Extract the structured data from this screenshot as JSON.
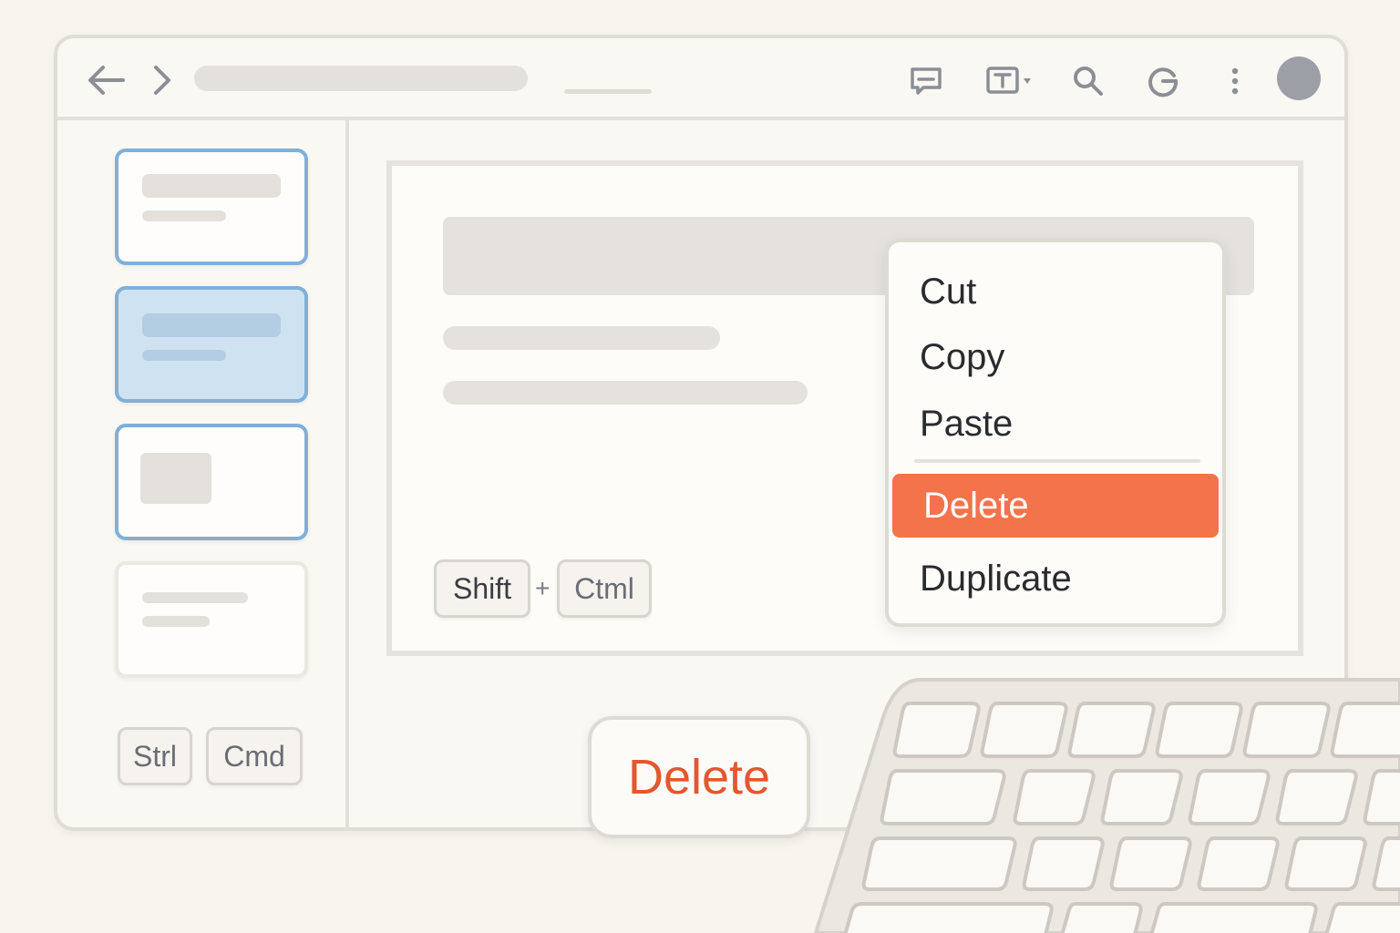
{
  "toolbar": {
    "icons": [
      "back-arrow-icon",
      "forward-chevron-icon",
      "comment-icon",
      "text-format-icon",
      "search-icon",
      "refresh-icon",
      "more-vertical-icon",
      "avatar"
    ]
  },
  "sidebar": {
    "slides": [
      {
        "state": "outlined"
      },
      {
        "state": "selected"
      },
      {
        "state": "outlined"
      },
      {
        "state": "plain"
      }
    ],
    "keys": [
      "Strl",
      "Cmd"
    ]
  },
  "canvas": {
    "shortcut": {
      "key1": "Shift",
      "plus": "+",
      "key2": "Ctml"
    }
  },
  "context_menu": {
    "items": [
      "Cut",
      "Copy",
      "Paste",
      "Delete",
      "Duplicate"
    ],
    "highlighted": "Delete"
  },
  "delete_key_label": "Delete",
  "colors": {
    "accent": "#f3734b",
    "delete_text": "#e4572e",
    "selection_border": "#7fb0d9",
    "selection_fill": "#cfe2f2"
  }
}
